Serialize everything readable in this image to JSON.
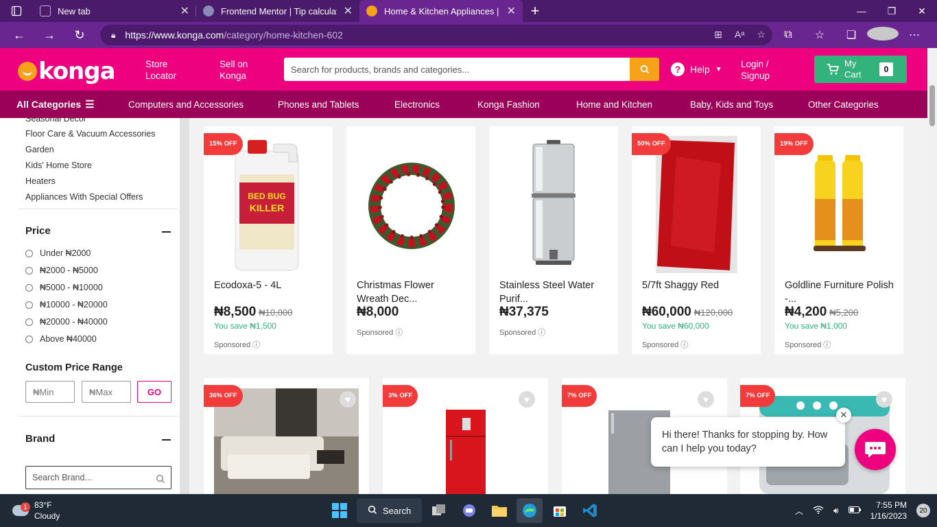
{
  "browser": {
    "tabs": [
      {
        "title": "New tab",
        "icon": "new-tab-page-icon",
        "color": "#7a3a8f"
      },
      {
        "title": "Frontend Mentor | Tip calculator",
        "icon": "frontend-mentor-icon",
        "color": "#8b8bb8"
      },
      {
        "title": "Home & Kitchen Appliances | Bu",
        "icon": "konga-favicon-icon",
        "color": "#f7a21b"
      }
    ],
    "url_host": "https://www.konga.com",
    "url_path": "/category/home-kitchen-602"
  },
  "header": {
    "logo": "konga",
    "store_locator": "Store\nLocator",
    "sell_on_konga": "Sell on\nKonga",
    "search_placeholder": "Search for products, brands and categories...",
    "help": "Help",
    "login": "Login /\nSignup",
    "cart_label": "My\nCart",
    "cart_count": "0"
  },
  "categories": {
    "all": "All Categories",
    "items": [
      "Computers and Accessories",
      "Phones and Tablets",
      "Electronics",
      "Konga Fashion",
      "Home and Kitchen",
      "Baby, Kids and Toys",
      "Other Categories"
    ]
  },
  "sidebar": {
    "cut_item": "Seasonal Decor",
    "links": [
      "Floor Care & Vacuum Accessories",
      "Garden",
      "Kids' Home Store",
      "Heaters",
      "Appliances With Special Offers"
    ],
    "price_heading": "Price",
    "price_options": [
      "Under ₦2000",
      "₦2000 - ₦5000",
      "₦5000 - ₦10000",
      "₦10000 - ₦20000",
      "₦20000 - ₦40000",
      "Above ₦40000"
    ],
    "custom_range_heading": "Custom Price Range",
    "min_placeholder": "₦Min",
    "max_placeholder": "₦Max",
    "go_label": "GO",
    "brand_heading": "Brand",
    "brand_placeholder": "Search Brand..."
  },
  "products_row1": [
    {
      "badge": "15% OFF",
      "name": "Ecodoxa-5 - 4L",
      "price": "₦8,500",
      "old_price": "₦10,000",
      "save": "You save ₦1,500",
      "sponsored": "Sponsored"
    },
    {
      "badge": "",
      "name": "Christmas Flower Wreath Dec...",
      "price": "₦8,000",
      "old_price": "",
      "save": "",
      "sponsored": "Sponsored"
    },
    {
      "badge": "",
      "name": "Stainless Steel Water Purif...",
      "price": "₦37,375",
      "old_price": "",
      "save": "",
      "sponsored": "Sponsored"
    },
    {
      "badge": "50% OFF",
      "name": "5/7ft Shaggy Red",
      "price": "₦60,000",
      "old_price": "₦120,000",
      "save": "You save ₦60,000",
      "sponsored": "Sponsored"
    },
    {
      "badge": "19% OFF",
      "name": "Goldline Furniture Polish -...",
      "price": "₦4,200",
      "old_price": "₦5,200",
      "save": "You save ₦1,000",
      "sponsored": "Sponsored"
    }
  ],
  "products_row2": [
    {
      "badge": "36% OFF"
    },
    {
      "badge": "3% OFF"
    },
    {
      "badge": "7% OFF"
    },
    {
      "badge": "7% OFF"
    }
  ],
  "chat": {
    "message": "Hi there! Thanks for stopping by. How can I help you today?"
  },
  "taskbar": {
    "temperature": "83°F",
    "condition": "Cloudy",
    "weather_badge": "1",
    "search_label": "Search",
    "time": "7:55 PM",
    "date": "1/16/2023",
    "notification_count": "20"
  },
  "colors": {
    "brand_pink": "#ed017f",
    "brand_dark": "#9b0158",
    "cart_green": "#33b27b",
    "search_orange": "#f7a21b",
    "badge_red": "#f23b3b"
  }
}
